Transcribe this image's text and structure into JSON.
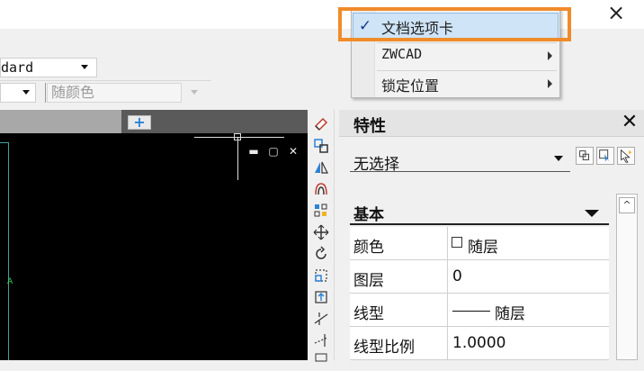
{
  "window": {
    "close_icon": "×"
  },
  "ribbon": {
    "text_style": "dard",
    "layer": "",
    "color": "随颜色"
  },
  "drawing": {
    "new_tab": "+",
    "viewport_controls": [
      "▬",
      "▢",
      "✕"
    ],
    "ucs_label": "A"
  },
  "properties": {
    "title": "特性",
    "close": "✕",
    "selection": "无选择",
    "section": "基本",
    "rows": [
      {
        "label": "颜色",
        "value": "随层"
      },
      {
        "label": "图层",
        "value": "0"
      },
      {
        "label": "线型",
        "value": "随层"
      },
      {
        "label": "线型比例",
        "value": "1.0000"
      }
    ],
    "scroll_up": "^"
  },
  "context_menu": {
    "items": [
      {
        "label": "文档选项卡",
        "checked": true,
        "check": "✓"
      },
      {
        "label": "ZWCAD",
        "submenu": true
      },
      {
        "label": "锁定位置",
        "submenu": true
      }
    ]
  },
  "colors": {
    "highlight": "#f08b2a",
    "menu_hover": "#cfe4f7",
    "canvas": "#000000",
    "accent_blue": "#2d82d6"
  }
}
